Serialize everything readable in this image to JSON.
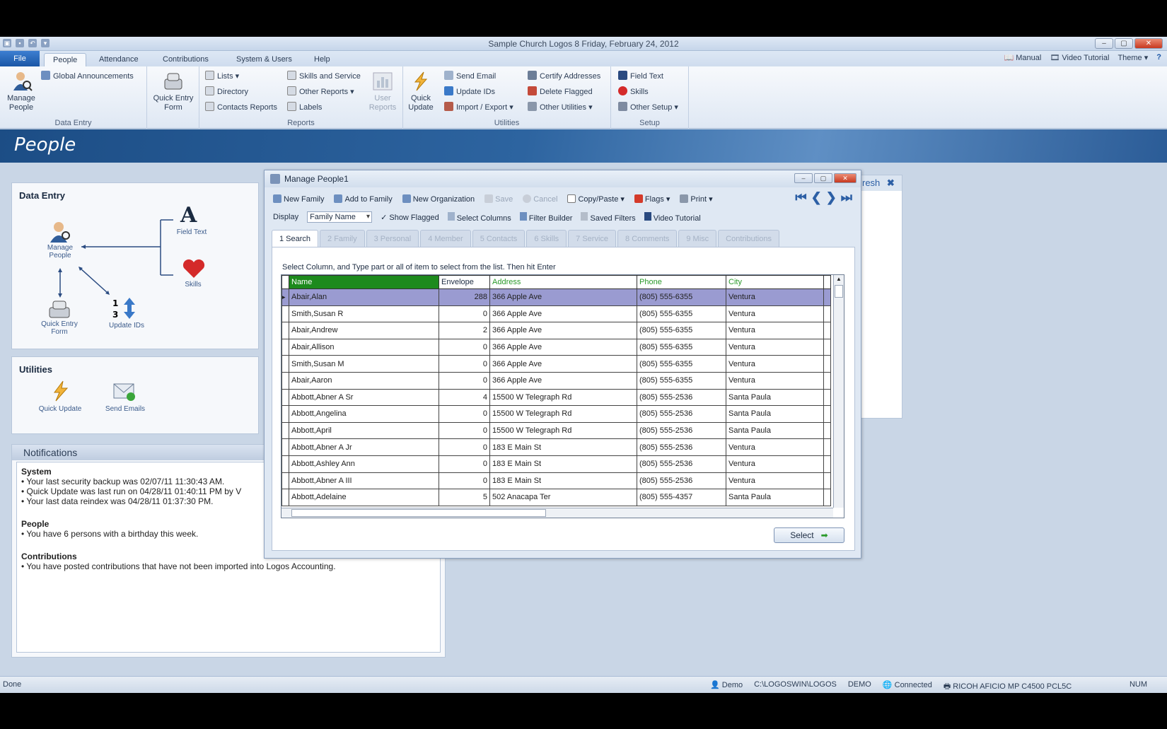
{
  "window": {
    "title": "Sample Church Logos 8 Friday, February 24, 2012"
  },
  "ribbon_tabs": [
    "File",
    "People",
    "Attendance",
    "Contributions",
    "System & Users",
    "Help"
  ],
  "right_links": {
    "manual": "Manual",
    "video": "Video Tutorial",
    "theme": "Theme"
  },
  "ribbon": {
    "manage_people": "Manage People",
    "global_announcements": "Global Announcements",
    "quick_entry_form": "Quick Entry Form",
    "data_entry_label": "Data Entry",
    "lists": "Lists",
    "directory": "Directory",
    "contacts_reports": "Contacts Reports",
    "skills_service": "Skills and Service",
    "other_reports": "Other Reports",
    "labels": "Labels",
    "user_reports": "User Reports",
    "reports_label": "Reports",
    "quick_update": "Quick Update",
    "send_email": "Send Email",
    "update_ids": "Update IDs",
    "import_export": "Import / Export",
    "certify_addresses": "Certify Addresses",
    "delete_flagged": "Delete Flagged",
    "other_utilities": "Other Utilities",
    "utilities_label": "Utilities",
    "field_text": "Field Text",
    "skills": "Skills",
    "other_setup": "Other Setup",
    "setup_label": "Setup"
  },
  "banner": {
    "title": "People"
  },
  "data_entry_panel": {
    "title": "Data Entry",
    "manage_people": "Manage People",
    "field_text": "Field Text",
    "skills": "Skills",
    "quick_entry": "Quick Entry Form",
    "update_ids": "Update IDs"
  },
  "utilities_panel": {
    "title": "Utilities",
    "quick_update": "Quick Update",
    "send_emails": "Send Emails"
  },
  "notifications": {
    "title": "Notifications",
    "system_head": "System",
    "system_lines": [
      "• Your last security backup was 02/07/11 11:30:43 AM.",
      "• Quick Update was last run on 04/28/11 01:40:11 PM by V",
      "• Your last data reindex was 04/28/11 01:37:30 PM."
    ],
    "people_head": "People",
    "people_line": "• You have 6 persons with a birthday this week.",
    "contrib_head": "Contributions",
    "contrib_line": "• You have posted contributions that have not been imported into Logos Accounting."
  },
  "behind_window": {
    "refresh": "resh"
  },
  "dialog": {
    "title": "Manage People1",
    "toolbar": {
      "new_family": "New Family",
      "add_to_family": "Add to Family",
      "new_org": "New Organization",
      "save": "Save",
      "cancel": "Cancel",
      "copy_paste": "Copy/Paste",
      "flags": "Flags",
      "print": "Print"
    },
    "toolbar2": {
      "display": "Display",
      "display_value": "Family Name",
      "show_flagged": "Show Flagged",
      "select_columns": "Select Columns",
      "filter_builder": "Filter Builder",
      "saved_filters": "Saved Filters",
      "video_tutorial": "Video Tutorial"
    },
    "tabs": [
      "1 Search",
      "2 Family",
      "3 Personal",
      "4 Member",
      "5 Contacts",
      "6 Skills",
      "7 Service",
      "8 Comments",
      "9 Misc",
      "Contributions"
    ],
    "instruction": "Select Column, and Type part or all  of item to select from the list. Then hit Enter",
    "columns": [
      "Name",
      "Envelope",
      "Address",
      "Phone",
      "City"
    ],
    "rows": [
      {
        "name": "Abair,Alan",
        "env": "288",
        "addr": "366 Apple Ave",
        "phone": "(805) 555-6355",
        "city": "Ventura"
      },
      {
        "name": "Smith,Susan R",
        "env": "0",
        "addr": "366 Apple Ave",
        "phone": "(805) 555-6355",
        "city": "Ventura"
      },
      {
        "name": "Abair,Andrew",
        "env": "2",
        "addr": "366 Apple Ave",
        "phone": "(805) 555-6355",
        "city": "Ventura"
      },
      {
        "name": "Abair,Allison",
        "env": "0",
        "addr": "366 Apple Ave",
        "phone": "(805) 555-6355",
        "city": "Ventura"
      },
      {
        "name": "Smith,Susan M",
        "env": "0",
        "addr": "366 Apple Ave",
        "phone": "(805) 555-6355",
        "city": "Ventura"
      },
      {
        "name": "Abair,Aaron",
        "env": "0",
        "addr": "366 Apple Ave",
        "phone": "(805) 555-6355",
        "city": "Ventura"
      },
      {
        "name": "Abbott,Abner A Sr",
        "env": "4",
        "addr": "15500 W Telegraph Rd",
        "phone": "(805) 555-2536",
        "city": "Santa Paula"
      },
      {
        "name": "Abbott,Angelina",
        "env": "0",
        "addr": "15500 W Telegraph Rd",
        "phone": "(805) 555-2536",
        "city": "Santa Paula"
      },
      {
        "name": "Abbott,April",
        "env": "0",
        "addr": "15500 W Telegraph Rd",
        "phone": "(805) 555-2536",
        "city": "Santa Paula"
      },
      {
        "name": "Abbott,Abner A Jr",
        "env": "0",
        "addr": "183 E Main St",
        "phone": "(805) 555-2536",
        "city": "Ventura"
      },
      {
        "name": "Abbott,Ashley Ann",
        "env": "0",
        "addr": "183 E Main St",
        "phone": "(805) 555-2536",
        "city": "Ventura"
      },
      {
        "name": "Abbott,Abner A III",
        "env": "0",
        "addr": "183 E Main St",
        "phone": "(805) 555-2536",
        "city": "Ventura"
      },
      {
        "name": "Abbott,Adelaine",
        "env": "5",
        "addr": "502 Anacapa Ter",
        "phone": "(805) 555-4357",
        "city": "Santa Paula"
      }
    ],
    "select_button": "Select"
  },
  "status": {
    "left": "Done",
    "user": "Demo",
    "path": "C:\\LOGOSWIN\\LOGOS",
    "mode": "DEMO",
    "connection": "Connected",
    "printer": "RICOH AFICIO MP C4500 PCL5C",
    "num": "NUM"
  },
  "colors": {
    "accent": "#1a56a6",
    "banner": "#2d64a0",
    "selected_header": "#1d8a1d",
    "current_row": "#9a9bd1"
  }
}
